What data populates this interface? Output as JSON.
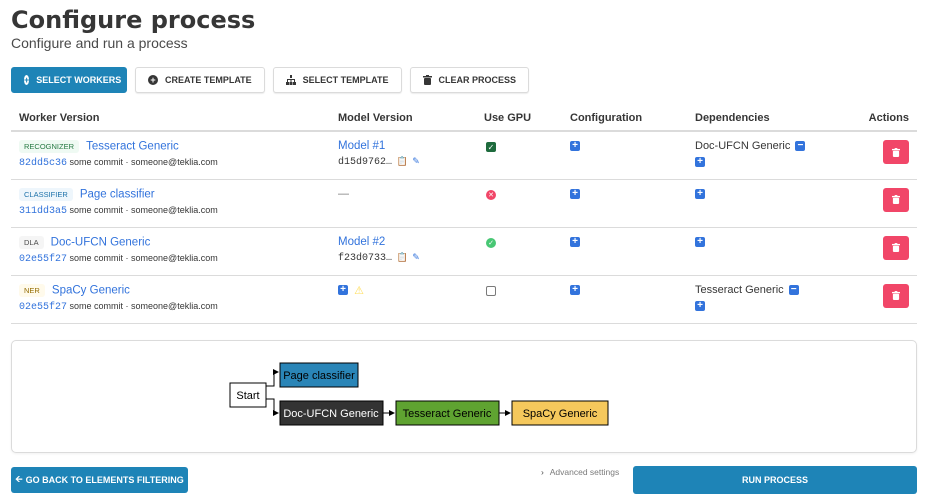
{
  "header": {
    "title": "Configure process",
    "subtitle": "Configure and run a process"
  },
  "toolbar": {
    "select_workers": "SELECT WORKERS",
    "create_template": "CREATE TEMPLATE",
    "select_template": "SELECT TEMPLATE",
    "clear_process": "CLEAR PROCESS"
  },
  "table": {
    "headers": {
      "worker_version": "Worker Version",
      "model_version": "Model Version",
      "use_gpu": "Use GPU",
      "configuration": "Configuration",
      "dependencies": "Dependencies",
      "actions": "Actions"
    },
    "rows": [
      {
        "tag": "RECOGNIZER",
        "name": "Tesseract Generic",
        "hash": "82dd5c36",
        "commit": "some commit · someone@teklia.com",
        "model_name": "Model #1",
        "model_hash": "d15d9762…",
        "gpu": "checked",
        "dependency": "Doc-UFCN Generic"
      },
      {
        "tag": "CLASSIFIER",
        "name": "Page classifier",
        "hash": "311dd3a5",
        "commit": "some commit · someone@teklia.com",
        "model_dash": "—",
        "gpu": "error"
      },
      {
        "tag": "DLA",
        "name": "Doc-UFCN Generic",
        "hash": "02e55f27",
        "commit": "some commit · someone@teklia.com",
        "model_name": "Model #2",
        "model_hash": "f23d0733…",
        "gpu": "ok"
      },
      {
        "tag": "NER",
        "name": "SpaCy Generic",
        "hash": "02e55f27",
        "commit": "some commit · someone@teklia.com",
        "gpu": "unchecked",
        "dependency": "Tesseract Generic"
      }
    ]
  },
  "graph": {
    "nodes": {
      "start": "Start",
      "page_classifier": "Page classifier",
      "doc_ufcn": "Doc-UFCN Generic",
      "tesseract": "Tesseract Generic",
      "spacy": "SpaCy Generic"
    },
    "colors": {
      "page_classifier": "#2a85b7",
      "doc_ufcn": "#333333",
      "tesseract": "#5fa331",
      "spacy": "#f5c85c"
    }
  },
  "footer": {
    "back": "GO BACK TO ELEMENTS FILTERING",
    "advanced": "Advanced settings",
    "run": "RUN PROCESS"
  },
  "icons": {
    "plus_circle": "plus-circle-icon",
    "trash": "trash-icon",
    "sitemap": "sitemap-icon",
    "clipboard": "clipboard-icon",
    "pencil": "pencil-icon",
    "warning": "warning-icon",
    "chevron": "chevron-right-icon",
    "arrow_left": "arrow-left-icon"
  }
}
